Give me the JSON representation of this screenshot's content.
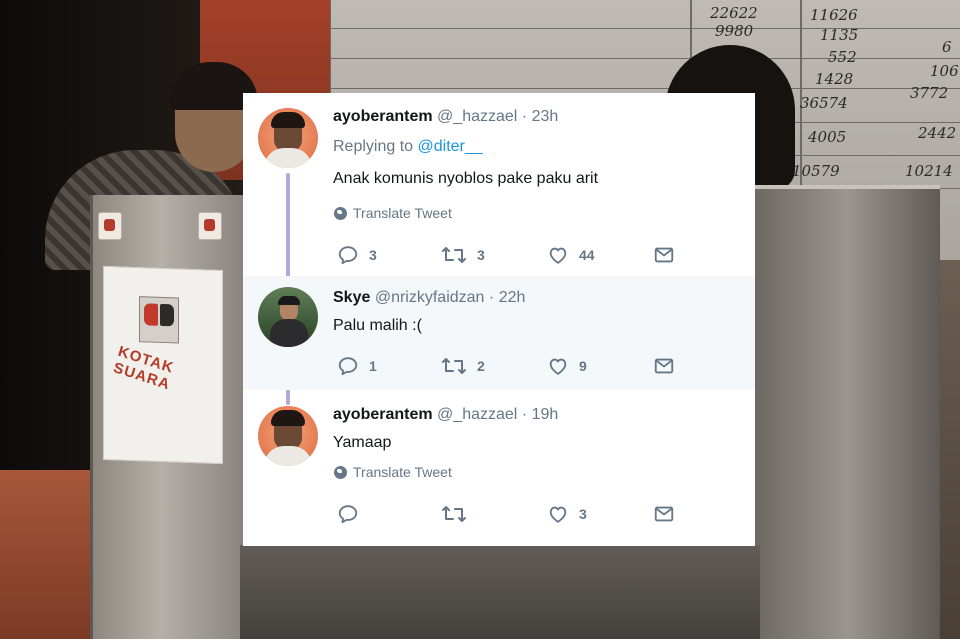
{
  "colors": {
    "accent": "#1b95e0",
    "muted": "#657786",
    "text": "#14171a",
    "thread_line": "#b9a6db",
    "shaded_bg": "#f5f8fa"
  },
  "background": {
    "sign_text": "KOTAK SUARA",
    "board_numbers": [
      "22622",
      "11626",
      "9980",
      "1135",
      "552",
      "1428",
      "36574",
      "4005",
      "2442",
      "10579",
      "10214",
      "3772",
      "106",
      "6"
    ]
  },
  "tweets": [
    {
      "display_name": "ayoberantem",
      "handle": "@_hazzael",
      "separator": "·",
      "time": "23h",
      "replying_label": "Replying to",
      "replying_to": "@diter__",
      "text": "Anak komunis nyoblos pake paku arit",
      "translate_label": "Translate Tweet",
      "replies": "3",
      "retweets": "3",
      "likes": "44"
    },
    {
      "display_name": "Skye",
      "handle": "@nrizkyfaidzan",
      "separator": "·",
      "time": "22h",
      "text": "Palu malih :(",
      "replies": "1",
      "retweets": "2",
      "likes": "9"
    },
    {
      "display_name": "ayoberantem",
      "handle": "@_hazzael",
      "separator": "·",
      "time": "19h",
      "text": "Yamaap",
      "translate_label": "Translate Tweet",
      "replies": "",
      "retweets": "",
      "likes": "3"
    }
  ],
  "icons": {
    "reply": "reply-icon",
    "retweet": "retweet-icon",
    "like": "heart-icon",
    "message": "envelope-icon",
    "translate": "globe-icon"
  }
}
